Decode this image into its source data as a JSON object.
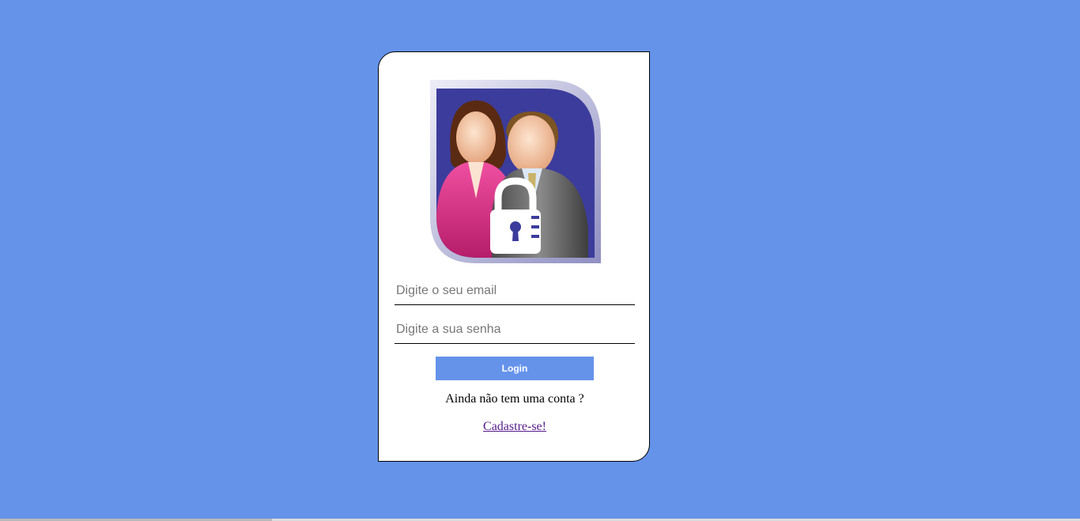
{
  "login": {
    "avatar_icon": "users-lock-icon",
    "email_placeholder": "Digite o seu email",
    "password_placeholder": "Digite a sua senha",
    "login_label": "Login",
    "no_account_text": "Ainda não tem uma conta ?",
    "signup_link": "Cadastre-se!"
  },
  "colors": {
    "background": "#6593ea",
    "button": "#6593ea",
    "link": "#551a8b"
  }
}
